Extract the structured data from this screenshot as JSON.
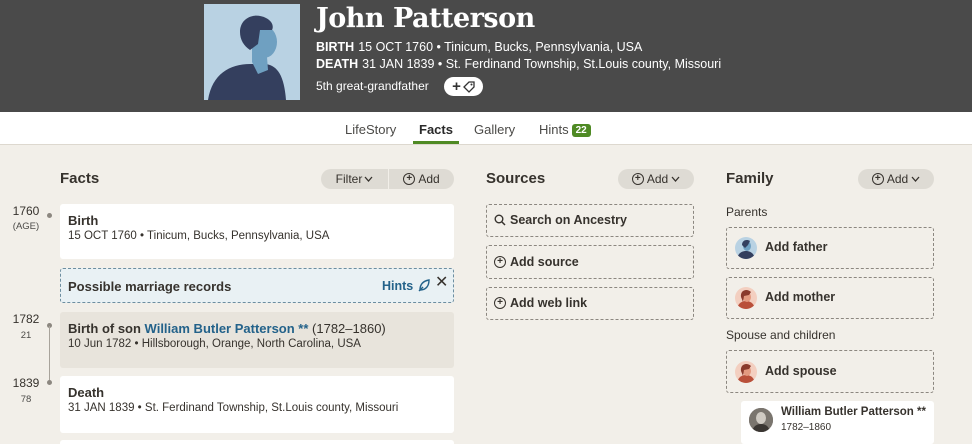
{
  "person": {
    "name": "John Patterson",
    "birth_label": "BIRTH",
    "birth_text": "15 OCT 1760 • Tinicum, Bucks, Pennsylvania, USA",
    "death_label": "DEATH",
    "death_text": "31 JAN 1839 • St. Ferdinand Township, St.Louis county, Missouri",
    "relationship": "5th great-grandfather"
  },
  "tabs": [
    {
      "label": "LifeStory"
    },
    {
      "label": "Facts",
      "active": true
    },
    {
      "label": "Gallery"
    },
    {
      "label": "Hints",
      "count": "22"
    }
  ],
  "facts_section": {
    "title": "Facts",
    "filter_label": "Filter",
    "add_label": "Add"
  },
  "timeline": [
    {
      "year": "1760",
      "age": "(AGE)"
    },
    {
      "year": "1782",
      "age": "21"
    },
    {
      "year": "1839",
      "age": "78"
    }
  ],
  "facts": [
    {
      "title": "Birth",
      "detail": "15 OCT 1760 • Tinicum, Bucks, Pennsylvania, USA"
    },
    {
      "title_prefix": "Birth of son ",
      "title_link": "William Butler Patterson **",
      "title_suffix": " (1782–1860)",
      "detail": "10 Jun 1782 • Hillsborough, Orange, North Carolina, USA"
    },
    {
      "title": "Death",
      "detail": "31 JAN 1839 • St. Ferdinand Township, St.Louis county, Missouri"
    }
  ],
  "hint_card": {
    "text": "Possible marriage records",
    "link": "Hints"
  },
  "sources_section": {
    "title": "Sources",
    "add_label": "Add",
    "search": "Search on Ancestry",
    "add_source": "Add source",
    "add_web_link": "Add web link"
  },
  "family_section": {
    "title": "Family",
    "add_label": "Add",
    "parents_label": "Parents",
    "add_father": "Add father",
    "add_mother": "Add mother",
    "spouse_label": "Spouse and children",
    "add_spouse": "Add spouse",
    "child_name": "William Butler Patterson **",
    "child_dates": "1782–1860"
  },
  "colors": {
    "header_bg": "#4a4a4a",
    "accent_green": "#4f8a24",
    "link_blue": "#23628a",
    "page_bg": "#f2efe9"
  }
}
